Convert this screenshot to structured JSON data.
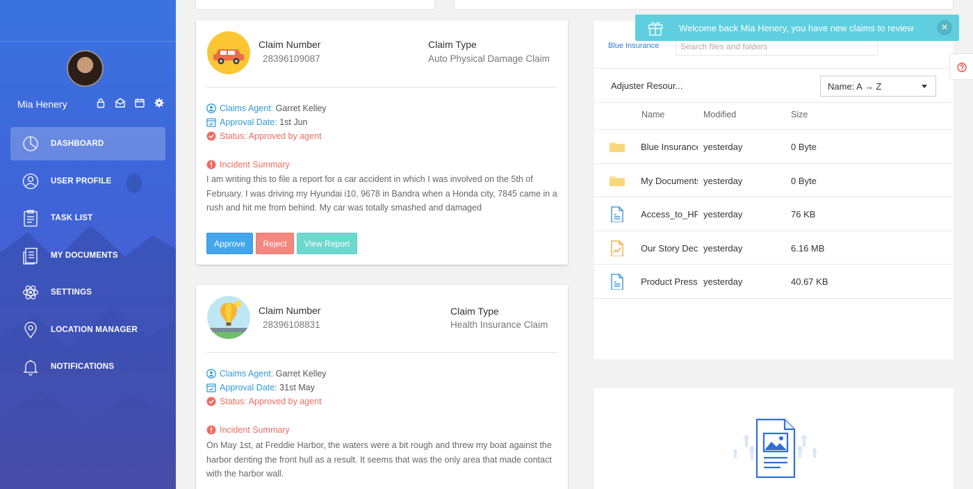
{
  "user": {
    "name": "Mia Henery"
  },
  "nav": {
    "items": [
      {
        "label": "DASHBOARD",
        "icon": "pie-chart-icon",
        "active": true
      },
      {
        "label": "USER PROFILE",
        "icon": "user-icon"
      },
      {
        "label": "TASK LIST",
        "icon": "clipboard-icon"
      },
      {
        "label": "MY DOCUMENTS",
        "icon": "documents-icon"
      },
      {
        "label": "SETTINGS",
        "icon": "atom-icon"
      },
      {
        "label": "LOCATION MANAGER",
        "icon": "map-pin-icon"
      },
      {
        "label": "NOTIFICATIONS",
        "icon": "bell-icon"
      }
    ]
  },
  "claims": [
    {
      "number_label": "Claim Number",
      "number": "28396109087",
      "type_label": "Claim Type",
      "type": "Auto Physical Damage Claim",
      "agent_label": "Claims Agent:",
      "agent": "Garret Kelley",
      "date_label": "Approval Date:",
      "date": "1st Jun",
      "status": "Status: Approved by agent",
      "summary_label": "Incident Summary",
      "summary": "I am writing this to file a report for a car accident in which I was involved on the 5th of February. I was driving my Hyundai i10, 9678 in Bandra when a Honda city, 7845 came in a rush and hit me from behind. My car was totally smashed and damaged",
      "actions": {
        "approve": "Approve",
        "reject": "Reject",
        "view": "View Report"
      }
    },
    {
      "number_label": "Claim Number",
      "number": "28396108831",
      "type_label": "Claim Type",
      "type": "Health Insurance Claim",
      "agent_label": "Claims Agent:",
      "agent": "Garret Kelley",
      "date_label": "Approval Date:",
      "date": "31st May",
      "status": "Status: Approved by agent",
      "summary_label": "Incident Summary",
      "summary": "On May 1st, at Freddie Harbor, the waters were a bit rough and threw my boat against the harbor denting the front hull as a result. It seems that was the only area that made contact with the harbor wall."
    }
  ],
  "files": {
    "breadcrumb": "Blue Insurance",
    "search_placeholder": "Search files and folders",
    "resource_title": "Adjuster Resour...",
    "sort": "Name: A → Z",
    "columns": {
      "name": "Name",
      "modified": "Modified",
      "size": "Size"
    },
    "rows": [
      {
        "name": "Blue Insurance",
        "modified": "yesterday",
        "size": "0 Byte",
        "icon": "folder-icon"
      },
      {
        "name": "My Documents",
        "modified": "yesterday",
        "size": "0 Byte",
        "icon": "folder-icon"
      },
      {
        "name": "Access_to_HR",
        "modified": "yesterday",
        "size": "76 KB",
        "icon": "document-icon"
      },
      {
        "name": "Our Story Deck",
        "modified": "yesterday",
        "size": "6.16 MB",
        "icon": "chart-file-icon"
      },
      {
        "name": "Product Press",
        "modified": "yesterday",
        "size": "40.67 KB",
        "icon": "document-icon"
      }
    ]
  },
  "toast": {
    "message": "Welcome back Mia Henery, you have new claims to review",
    "close": "×"
  },
  "colors": {
    "sidebar": "#3f64d8",
    "accent": "#2e9bd6",
    "danger": "#f06b62",
    "approve": "#42a6ec",
    "reject": "#f4877f",
    "view": "#6ed8ce",
    "toast": "#5fcfe0"
  }
}
